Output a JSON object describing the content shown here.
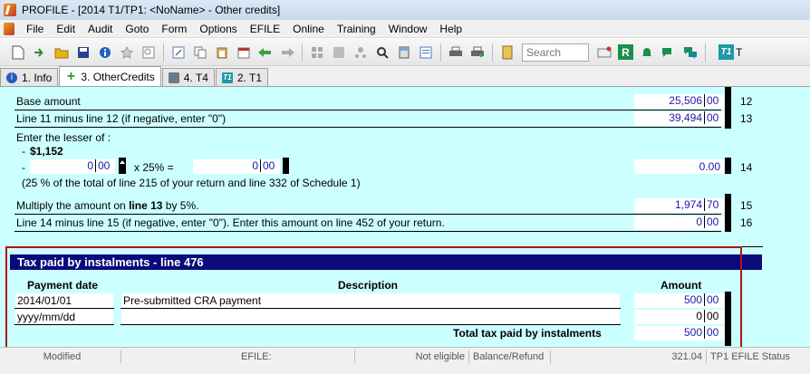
{
  "window": {
    "title": "PROFILE - [2014 T1/TP1: <NoName> - Other credits]"
  },
  "menu": [
    "File",
    "Edit",
    "Audit",
    "Goto",
    "Form",
    "Options",
    "EFILE",
    "Online",
    "Training",
    "Window",
    "Help"
  ],
  "toolbar": {
    "search_placeholder": "Search",
    "r_label": "R",
    "t1_label": "T1",
    "t_label": "T"
  },
  "tabs": [
    {
      "label": "1. Info",
      "icon": "info-icon"
    },
    {
      "label": "3. OtherCredits",
      "icon": "plus-icon"
    },
    {
      "label": "4. T4",
      "icon": "t4-icon"
    },
    {
      "label": "2. T1",
      "icon": "t1-icon"
    }
  ],
  "form": {
    "base_amount_label": "Base amount",
    "base_amount_dollars": "25,506",
    "base_amount_cents": "00",
    "line12": "12",
    "line11_label": "Line 11 minus line 12 (if negative, enter \"0\")",
    "line11_dollars": "39,494",
    "line11_cents": "00",
    "line13": "13",
    "lesser_label": "Enter the lesser of :",
    "lesser_item1_prefix": "-",
    "lesser_item1_value": "$1,152",
    "lesser_item2_prefix": "-",
    "lesser_input_dollars": "0",
    "lesser_input_cents": "00",
    "times_label": "x 25% =",
    "lesser_result_dollars": "0",
    "lesser_result_cents": "00",
    "line14_value": "0.00",
    "line14": "14",
    "note_label": "(25 % of the total of line 215 of your return and line 332 of Schedule 1)",
    "line15_label_a": "Multiply the amount on ",
    "line15_label_b": "line 13",
    "line15_label_c": " by 5%.",
    "line15_dollars": "1,974",
    "line15_cents": "70",
    "line15": "15",
    "line16_label": "Line 14 minus line 15 (if negative, enter \"0\"). Enter this amount on line 452 of your return.",
    "line16_dollars": "0",
    "line16_cents": "00",
    "line16": "16"
  },
  "instalments": {
    "title": "Tax paid by instalments - line 476",
    "col_date": "Payment date",
    "col_desc": "Description",
    "col_amount": "Amount",
    "rows": [
      {
        "date": "2014/01/01",
        "description": "Pre-submitted CRA payment",
        "dollars": "500",
        "cents": "00"
      },
      {
        "date": "yyyy/mm/dd",
        "description": "",
        "dollars": "0",
        "cents": "00"
      }
    ],
    "total_label": "Total tax paid by instalments",
    "total_dollars": "500",
    "total_cents": "00"
  },
  "status": {
    "modified": "Modified",
    "efile": "EFILE:",
    "eligibility": "Not eligible",
    "balance_label": "Balance/Refund",
    "balance_value": "321.04",
    "efile_status": "TP1 EFILE Status"
  }
}
